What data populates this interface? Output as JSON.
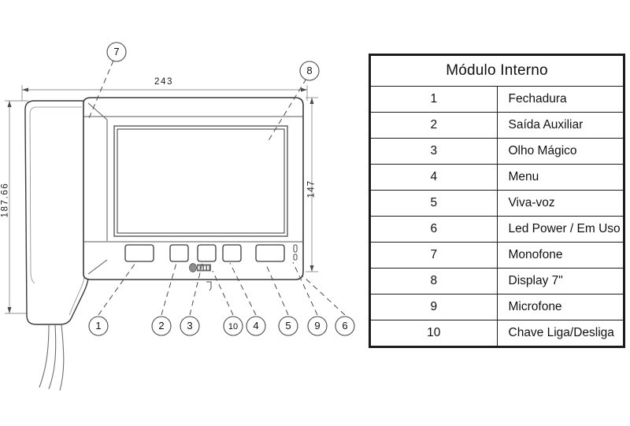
{
  "document": {
    "type": "technical-drawing",
    "subject": "Modulo Interno video intercom monitor"
  },
  "legend": {
    "title": "Módulo Interno",
    "rows": [
      {
        "num": "1",
        "label": "Fechadura"
      },
      {
        "num": "2",
        "label": "Saída Auxiliar"
      },
      {
        "num": "3",
        "label": "Olho Mágico"
      },
      {
        "num": "4",
        "label": "Menu"
      },
      {
        "num": "5",
        "label": "Viva-voz"
      },
      {
        "num": "6",
        "label": "Led Power / Em Uso"
      },
      {
        "num": "7",
        "label": "Monofone"
      },
      {
        "num": "8",
        "label": "Display 7\""
      },
      {
        "num": "9",
        "label": "Microfone"
      },
      {
        "num": "10",
        "label": "Chave Liga/Desliga"
      }
    ]
  },
  "dimensions": {
    "width": "243",
    "height": "187.66",
    "screen_height": "147"
  },
  "callouts": {
    "top": [
      {
        "id": "7",
        "label": "7"
      },
      {
        "id": "8",
        "label": "8"
      }
    ],
    "bottom": [
      {
        "id": "1",
        "label": "1"
      },
      {
        "id": "2",
        "label": "2"
      },
      {
        "id": "3",
        "label": "3"
      },
      {
        "id": "10",
        "label": "10"
      },
      {
        "id": "4",
        "label": "4"
      },
      {
        "id": "5",
        "label": "5"
      },
      {
        "id": "9",
        "label": "9"
      },
      {
        "id": "6",
        "label": "6"
      }
    ]
  },
  "device": {
    "buttons": [
      {
        "name": "button-lock"
      },
      {
        "name": "button-aux"
      },
      {
        "name": "button-peephole"
      },
      {
        "name": "button-menu"
      },
      {
        "name": "button-speaker"
      }
    ],
    "brand_mark": "ipec-logo"
  },
  "colors": {
    "line": "#3a3a3a",
    "line_light": "#8a8a8a",
    "table_border": "#1c1c1c",
    "text": "#111111",
    "background": "#ffffff"
  }
}
